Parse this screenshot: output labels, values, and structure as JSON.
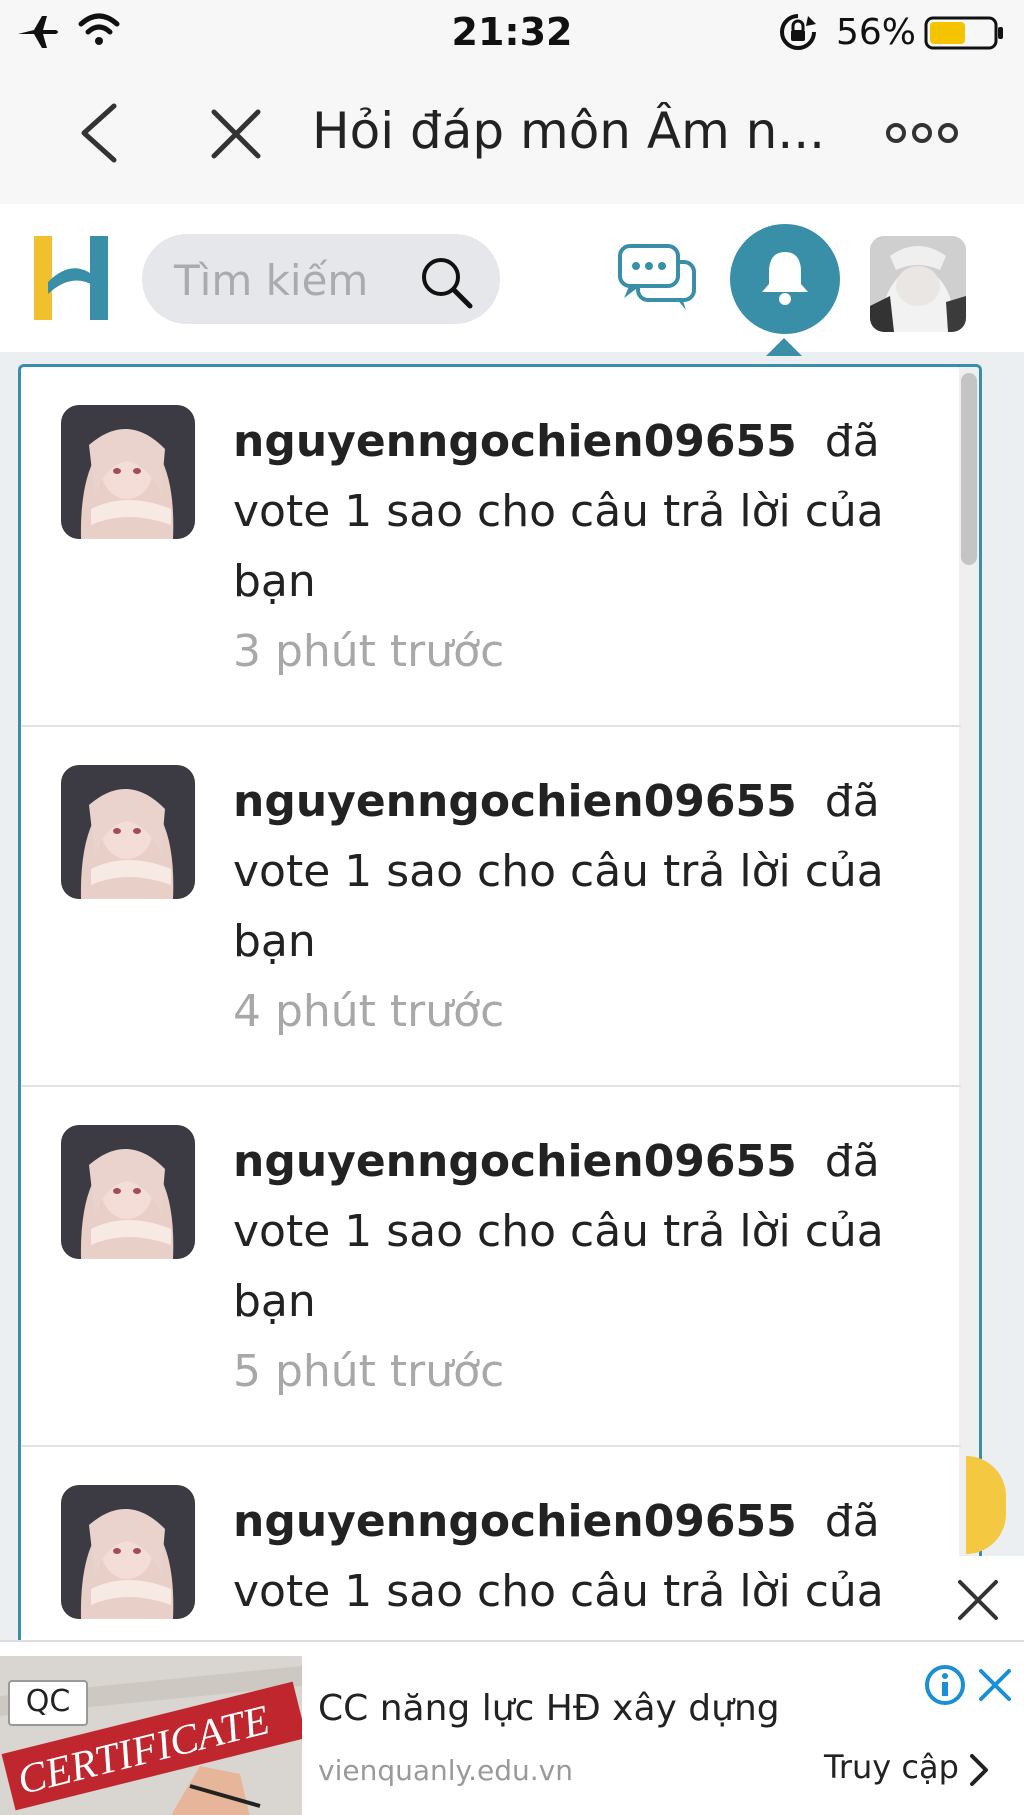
{
  "status_bar": {
    "time": "21:32",
    "battery_percent": "56%",
    "battery_level": 0.56
  },
  "nav_bar": {
    "title": "Hỏi đáp môn Âm n..."
  },
  "header": {
    "search_placeholder": "Tìm kiếm",
    "accent_color": "#3a8fa8",
    "logo_colors": [
      "#f0c02f",
      "#3a8fa8"
    ]
  },
  "notifications": [
    {
      "user": "nguyenngochien09655",
      "action": "đã vote 1 sao cho câu trả lời của bạn",
      "time": "3 phút trước"
    },
    {
      "user": "nguyenngochien09655",
      "action": "đã vote 1 sao cho câu trả lời của bạn",
      "time": "4 phút trước"
    },
    {
      "user": "nguyenngochien09655",
      "action": "đã vote 1 sao cho câu trả lời của bạn",
      "time": "5 phút trước"
    },
    {
      "user": "nguyenngochien09655",
      "action": "đã vote 1 sao cho câu trả lời của",
      "time": ""
    }
  ],
  "ad": {
    "badge": "QC",
    "image_text": "CERTIFICATE",
    "title": "CC năng lực HĐ xây dựng",
    "domain": "vienquanly.edu.vn",
    "cta": "Truy cập"
  },
  "icons": {
    "status": [
      "airplane-icon",
      "wifi-icon",
      "rotation-lock-icon",
      "battery-icon"
    ],
    "nav": [
      "back-icon",
      "close-icon",
      "more-icon"
    ],
    "header": [
      "search-icon",
      "chat-icon",
      "bell-icon"
    ]
  }
}
